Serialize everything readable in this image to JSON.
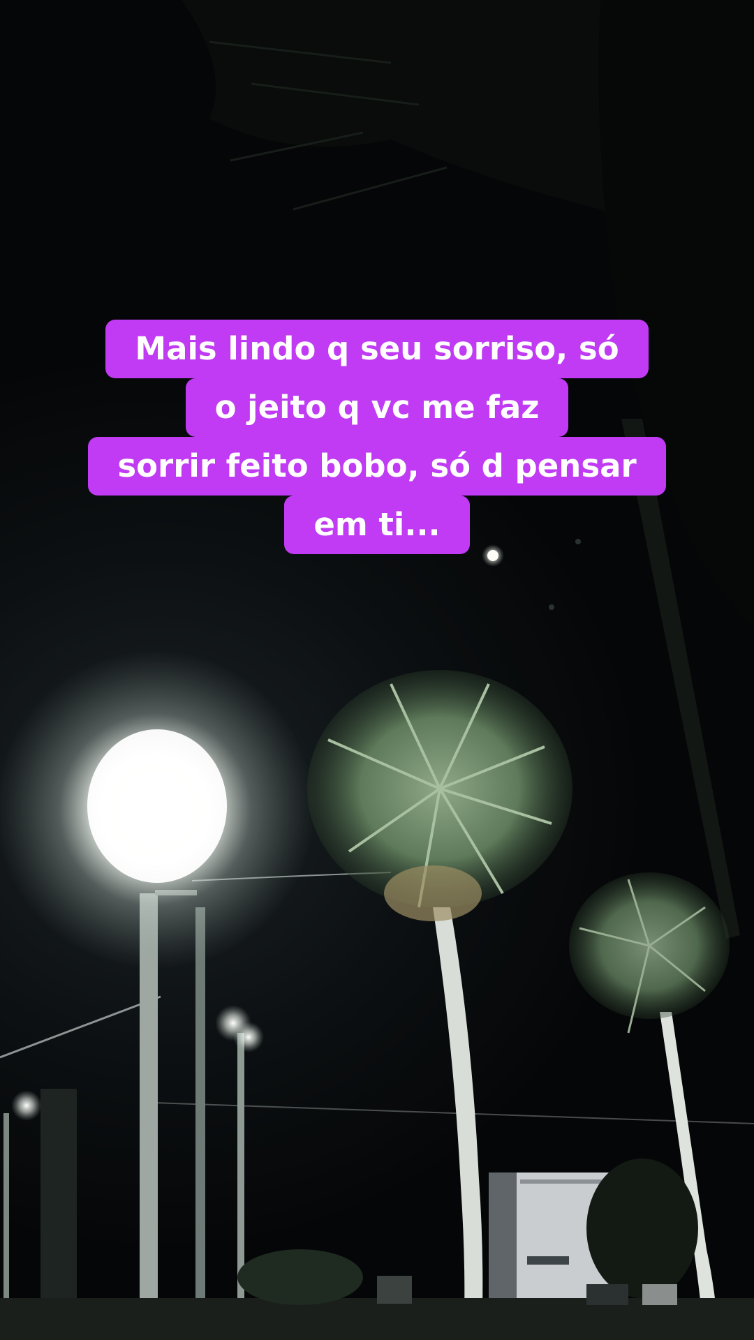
{
  "caption": {
    "lines": [
      "Mais lindo q seu sorriso, só",
      "o jeito q vc me faz",
      "sorrir feito bobo, só d pensar",
      "em ti..."
    ],
    "background_color": "#c13bf5",
    "text_color": "#ffffff"
  },
  "scene": {
    "setting": "night street",
    "elements": [
      "palm-tree",
      "street-lamp",
      "moon",
      "power-lines",
      "building"
    ]
  }
}
